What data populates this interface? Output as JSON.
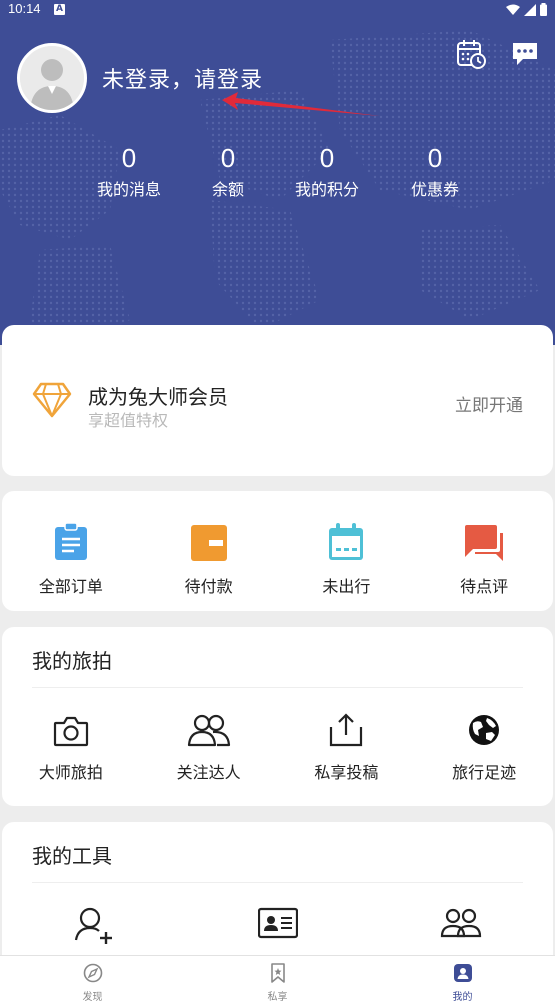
{
  "status": {
    "time": "10:14",
    "a_badge": "A"
  },
  "header": {
    "login_prompt": "未登录，请登录",
    "calendar_icon": "calendar-clock-icon",
    "message_icon": "chat-bubble-icon"
  },
  "stats": [
    {
      "value": "0",
      "label": "我的消息"
    },
    {
      "value": "0",
      "label": "余额"
    },
    {
      "value": "0",
      "label": "我的积分"
    },
    {
      "value": "0",
      "label": "优惠券"
    }
  ],
  "vip": {
    "title": "成为兔大师会员",
    "subtitle": "享超值特权",
    "action": "立即开通",
    "accent": "#f0a43a"
  },
  "orders": [
    {
      "label": "全部订单",
      "icon": "clipboard-icon",
      "color": "#4aa3e8"
    },
    {
      "label": "待付款",
      "icon": "wallet-icon",
      "color": "#f09a30"
    },
    {
      "label": "未出行",
      "icon": "calendar-icon",
      "color": "#4ec0d6"
    },
    {
      "label": "待点评",
      "icon": "comment-icon",
      "color": "#e55a43"
    }
  ],
  "travel": {
    "title": "我的旅拍",
    "items": [
      {
        "label": "大师旅拍",
        "icon": "camera-icon"
      },
      {
        "label": "关注达人",
        "icon": "users-icon"
      },
      {
        "label": "私享投稿",
        "icon": "upload-icon"
      },
      {
        "label": "旅行足迹",
        "icon": "globe-icon"
      }
    ]
  },
  "tools": {
    "title": "我的工具",
    "items": [
      {
        "icon": "add-user-icon"
      },
      {
        "icon": "id-card-icon"
      },
      {
        "icon": "group-icon"
      }
    ]
  },
  "nav": [
    {
      "label": "发现",
      "icon": "compass-icon"
    },
    {
      "label": "私享",
      "icon": "bookmark-icon"
    },
    {
      "label": "我的",
      "icon": "profile-icon",
      "active": true
    }
  ],
  "colors": {
    "header": "#3e4d96",
    "active_nav": "#3e4d96",
    "arrow": "#e02a3a"
  }
}
